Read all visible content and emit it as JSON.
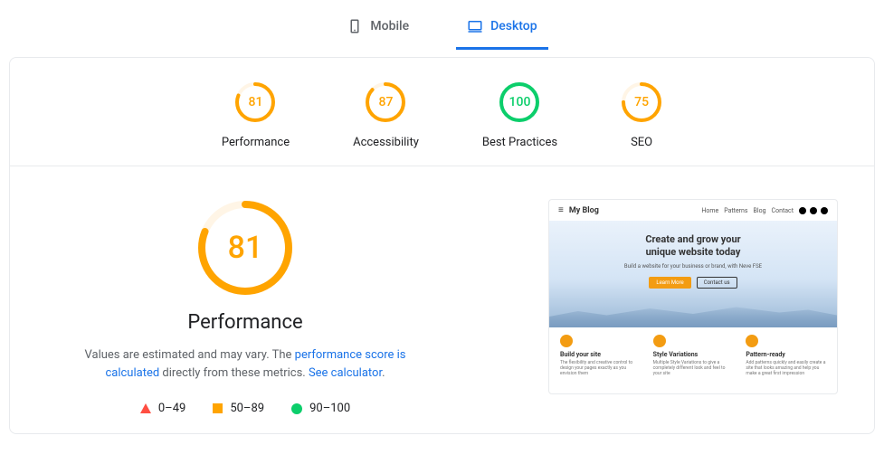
{
  "tabs": {
    "mobile": "Mobile",
    "desktop": "Desktop",
    "active": "desktop"
  },
  "gauges": [
    {
      "score": 81,
      "label": "Performance",
      "color": "#ffa400",
      "bg": "#fff5e6"
    },
    {
      "score": 87,
      "label": "Accessibility",
      "color": "#ffa400",
      "bg": "#fff5e6"
    },
    {
      "score": 100,
      "label": "Best Practices",
      "color": "#0cce6b",
      "bg": "#e6faef"
    },
    {
      "score": 75,
      "label": "SEO",
      "color": "#ffa400",
      "bg": "#fff5e6"
    }
  ],
  "main": {
    "score": 81,
    "color": "#ffa400",
    "bg": "#fff5e6",
    "title": "Performance",
    "desc_pre": "Values are estimated and may vary. The ",
    "link1": "performance score is calculated",
    "desc_mid": " directly from these metrics. ",
    "link2": "See calculator"
  },
  "legend": [
    {
      "range": "0–49"
    },
    {
      "range": "50–89"
    },
    {
      "range": "90–100"
    }
  ],
  "preview": {
    "site_title": "My Blog",
    "nav": [
      "Home",
      "Patterns",
      "Blog",
      "Contact"
    ],
    "h1_l1": "Create and grow your",
    "h1_l2": "unique website today",
    "sub": "Build a website for your business or brand, with Neve FSE",
    "btn1": "Learn More",
    "btn2": "Contact us",
    "features": [
      {
        "h": "Build your site",
        "t": "The flexibility and creative control to design your pages exactly as you envision them"
      },
      {
        "h": "Style Variations",
        "t": "Multiple Style Variations to give a completely different look and feel to your site"
      },
      {
        "h": "Pattern-ready",
        "t": "Add patterns quickly and easily create a site that looks amazing and help you make a great first impression"
      }
    ]
  }
}
